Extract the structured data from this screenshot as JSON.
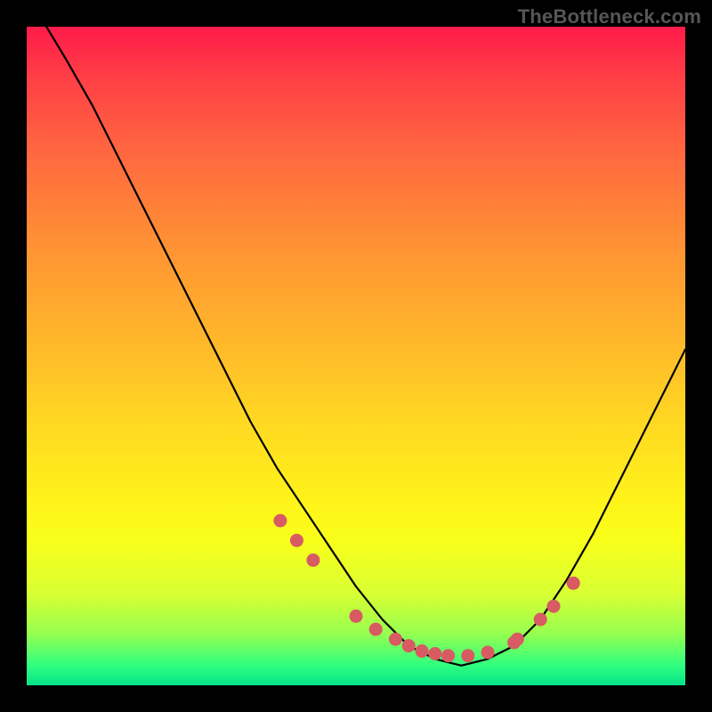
{
  "watermark": "TheBottleneck.com",
  "chart_data": {
    "type": "line",
    "title": "",
    "xlabel": "",
    "ylabel": "",
    "xlim": [
      0,
      100
    ],
    "ylim": [
      0,
      100
    ],
    "grid": false,
    "legend": false,
    "series": [
      {
        "name": "curve",
        "x": [
          3,
          6,
          10,
          14,
          18,
          22,
          26,
          30,
          34,
          38,
          42,
          46,
          50,
          54,
          56,
          58,
          60,
          62,
          66,
          70,
          74,
          78,
          82,
          86,
          90,
          94,
          98,
          100
        ],
        "y": [
          100,
          95,
          88,
          80,
          72,
          64,
          56,
          48,
          40,
          33,
          27,
          21,
          15,
          10,
          8,
          6,
          5,
          4,
          3,
          4,
          6,
          10,
          16,
          23,
          31,
          39,
          47,
          51
        ]
      }
    ],
    "markers": {
      "name": "highlight-points",
      "color": "#d85a63",
      "x": [
        38.5,
        41,
        43.5,
        50,
        53,
        56,
        58,
        60,
        62,
        64,
        67,
        70,
        74,
        74.5,
        78,
        80,
        83
      ],
      "y": [
        25,
        22,
        19,
        10.5,
        8.5,
        7,
        6,
        5.2,
        4.8,
        4.5,
        4.5,
        5,
        6.5,
        7,
        10,
        12,
        15.5
      ]
    },
    "gradient_stops": [
      {
        "pos": 0,
        "color": "#ff1b4a"
      },
      {
        "pos": 8,
        "color": "#ff4046"
      },
      {
        "pos": 20,
        "color": "#ff6a3f"
      },
      {
        "pos": 34,
        "color": "#ff9433"
      },
      {
        "pos": 48,
        "color": "#ffb82a"
      },
      {
        "pos": 60,
        "color": "#ffd822"
      },
      {
        "pos": 72,
        "color": "#fff31a"
      },
      {
        "pos": 78,
        "color": "#f8ff1a"
      },
      {
        "pos": 86,
        "color": "#d9ff33"
      },
      {
        "pos": 92,
        "color": "#98ff4e"
      },
      {
        "pos": 97,
        "color": "#2fff7f"
      },
      {
        "pos": 100,
        "color": "#06e38a"
      }
    ]
  }
}
